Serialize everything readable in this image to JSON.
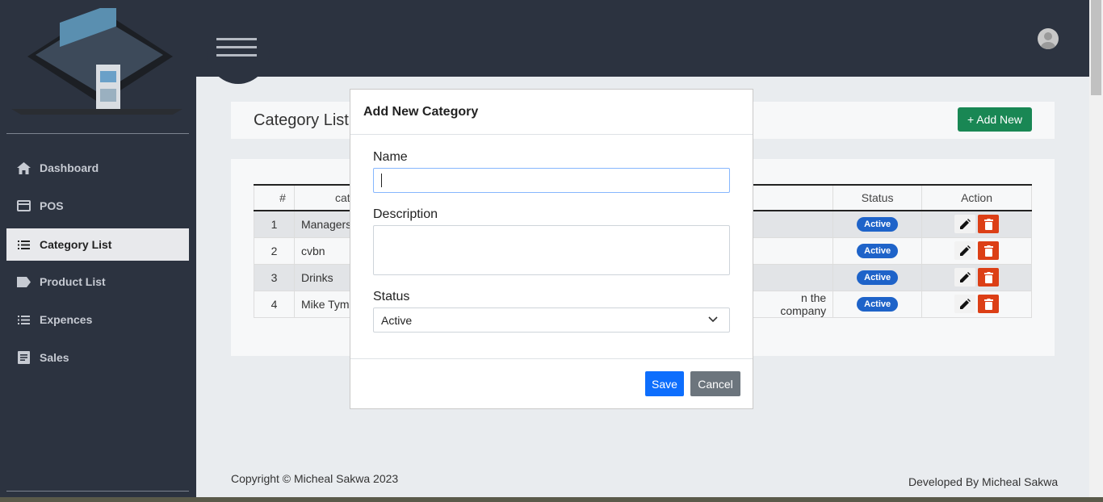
{
  "sidebar": {
    "items": [
      {
        "label": "Dashboard",
        "icon": "home-icon"
      },
      {
        "label": "POS",
        "icon": "card-icon"
      },
      {
        "label": "Category List",
        "icon": "list-icon",
        "active": true
      },
      {
        "label": "Product List",
        "icon": "tag-icon"
      },
      {
        "label": "Expences",
        "icon": "list-icon"
      },
      {
        "label": "Sales",
        "icon": "document-icon"
      }
    ]
  },
  "main": {
    "title": "Category List",
    "add_new_label": "+ Add New",
    "table": {
      "columns": [
        "#",
        "cat",
        "",
        "Status",
        "Action"
      ],
      "rows": [
        {
          "num": "1",
          "name": "Managers",
          "desc": "",
          "status": "Active"
        },
        {
          "num": "2",
          "name": "cvbn",
          "desc": "",
          "status": "Active"
        },
        {
          "num": "3",
          "name": "Drinks",
          "desc": "",
          "status": "Active"
        },
        {
          "num": "4",
          "name": "Mike Tym",
          "desc": "n the company",
          "status": "Active"
        }
      ]
    }
  },
  "footer": {
    "copyright": "Copyright © Micheal Sakwa 2023",
    "developer": "Developed By Micheal Sakwa"
  },
  "modal": {
    "title": "Add New Category",
    "name_label": "Name",
    "name_value": "",
    "description_label": "Description",
    "description_value": "",
    "status_label": "Status",
    "status_value": "Active",
    "save_label": "Save",
    "cancel_label": "Cancel"
  },
  "colors": {
    "sidebar_bg": "#2c3340",
    "add_new": "#198754",
    "badge": "#1e63c9",
    "delete": "#dc3f16",
    "save": "#0d6efd",
    "cancel": "#6c757d"
  }
}
